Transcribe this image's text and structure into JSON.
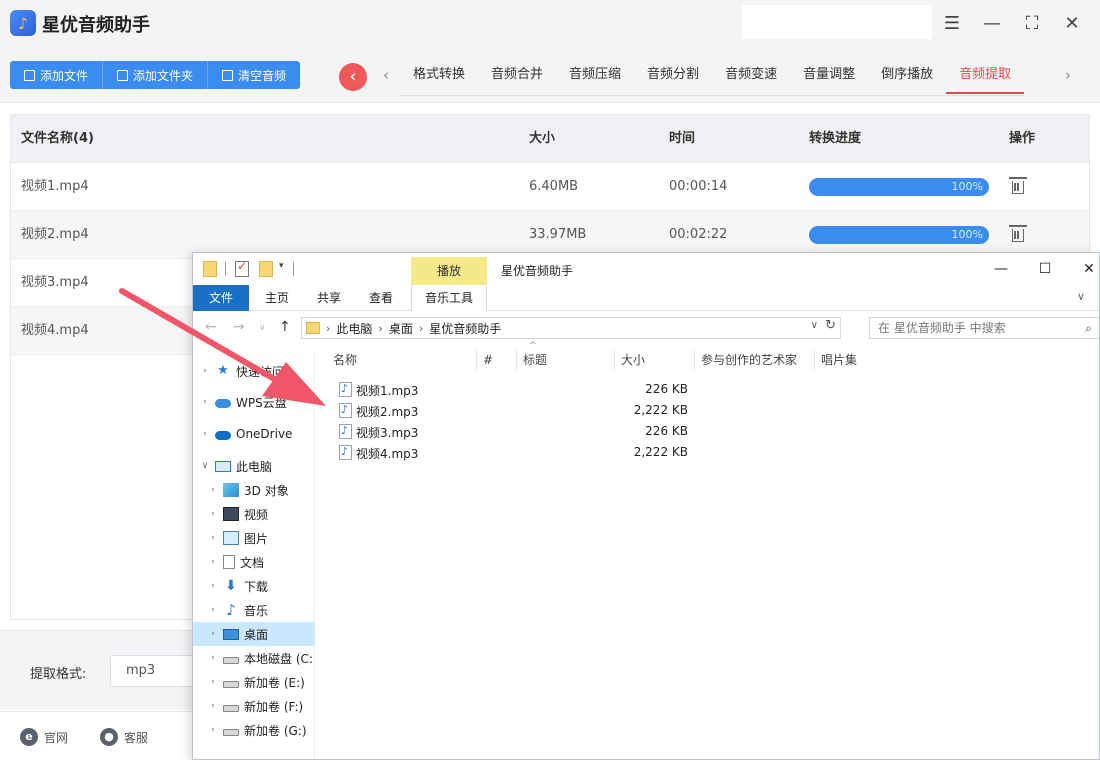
{
  "app": {
    "title": "星优音频助手",
    "window_controls": [
      "settings",
      "minimize",
      "maximize",
      "close"
    ]
  },
  "toolbar": {
    "add_file": "添加文件",
    "add_folder": "添加文件夹",
    "clear_audio": "清空音频"
  },
  "tabs": [
    {
      "label": "格式转换",
      "active": false
    },
    {
      "label": "音频合并",
      "active": false
    },
    {
      "label": "音频压缩",
      "active": false
    },
    {
      "label": "音频分割",
      "active": false
    },
    {
      "label": "音频变速",
      "active": false
    },
    {
      "label": "音量调整",
      "active": false
    },
    {
      "label": "倒序播放",
      "active": false
    },
    {
      "label": "音频提取",
      "active": true
    }
  ],
  "table": {
    "headers": {
      "name": "文件名称(4)",
      "size": "大小",
      "time": "时间",
      "progress": "转换进度",
      "action": "操作"
    },
    "rows": [
      {
        "name": "视频1.mp4",
        "size": "6.40MB",
        "time": "00:00:14",
        "progress": "100%"
      },
      {
        "name": "视频2.mp4",
        "size": "33.97MB",
        "time": "00:02:22",
        "progress": "100%"
      },
      {
        "name": "视频3.mp4"
      },
      {
        "name": "视频4.mp4"
      }
    ]
  },
  "bottom": {
    "format_label": "提取格式:",
    "format_value": "mp3"
  },
  "footer": {
    "website": "官网",
    "support": "客服"
  },
  "explorer": {
    "title": "星优音频助手",
    "context_tab": "播放",
    "ribbon": {
      "file": "文件",
      "home": "主页",
      "share": "共享",
      "view": "查看",
      "music_tools": "音乐工具"
    },
    "breadcrumb": [
      "此电脑",
      "桌面",
      "星优音频助手"
    ],
    "search_placeholder": "在 星优音频助手 中搜索",
    "nav": {
      "quick_access": "快速访问",
      "wps": "WPS云盘",
      "onedrive": "OneDrive",
      "this_pc": "此电脑",
      "objects3d": "3D 对象",
      "videos": "视频",
      "pictures": "图片",
      "documents": "文档",
      "downloads": "下载",
      "music": "音乐",
      "desktop": "桌面",
      "local_disk": "本地磁盘 (C:",
      "vol_e": "新加卷 (E:)",
      "vol_f": "新加卷 (F:)",
      "vol_g": "新加卷 (G:)"
    },
    "columns": {
      "name": "名称",
      "number": "#",
      "title": "标题",
      "size": "大小",
      "artist": "参与创作的艺术家",
      "album": "唱片集"
    },
    "files": [
      {
        "name": "视频1.mp3",
        "size": "226 KB"
      },
      {
        "name": "视频2.mp3",
        "size": "2,222 KB"
      },
      {
        "name": "视频3.mp3",
        "size": "226 KB"
      },
      {
        "name": "视频4.mp3",
        "size": "2,222 KB"
      }
    ]
  },
  "colors": {
    "primary": "#3b8cf0",
    "accent_red": "#e5484d",
    "arrow": "#f0566a"
  }
}
